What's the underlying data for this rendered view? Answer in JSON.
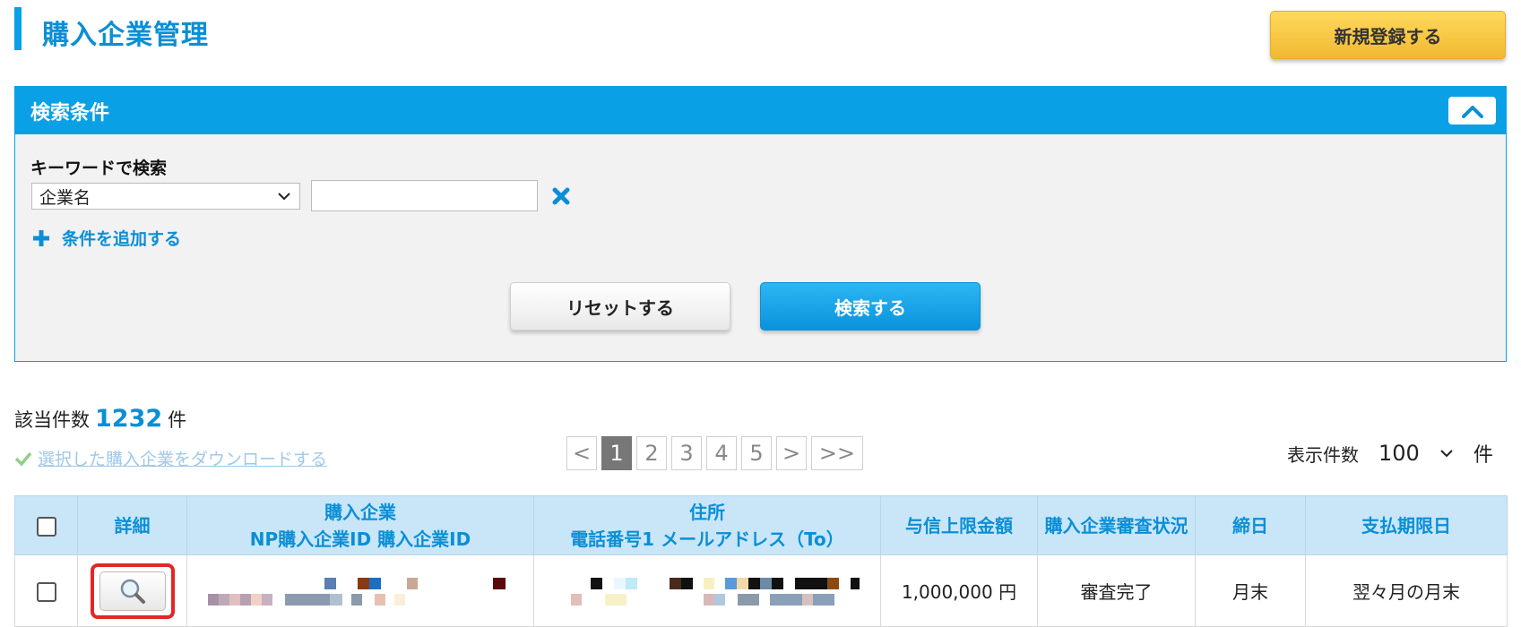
{
  "header": {
    "title": "購入企業管理",
    "register_label": "新規登録する",
    "colors": {
      "accent": "#0aa0e6",
      "register": "#f5c843"
    }
  },
  "search": {
    "title": "検索条件",
    "keyword_label": "キーワードで検索",
    "field_select_value": "企業名",
    "keyword_value": "",
    "add_condition_label": "条件を追加する",
    "reset_label": "リセットする",
    "search_label": "検索する",
    "icons": [
      "chevron-up-icon",
      "chevron-down-icon",
      "close-icon",
      "plus-icon"
    ]
  },
  "results": {
    "count_prefix": "該当件数",
    "count": "1232",
    "count_suffix": "件",
    "download_label": "選択した購入企業をダウンロードする",
    "pagination": [
      "<",
      "1",
      "2",
      "3",
      "4",
      "5",
      ">",
      ">>"
    ],
    "current_page": "1",
    "per_page_label": "表示件数",
    "per_page_value": "100",
    "per_page_unit": "件"
  },
  "table": {
    "headers": {
      "detail": "詳細",
      "company_line1": "購入企業",
      "company_line2": "NP購入企業ID 購入企業ID",
      "address_line1": "住所",
      "address_line2": "電話番号1 メールアドレス（To）",
      "credit_limit": "与信上限金額",
      "review_status": "購入企業審査状況",
      "closing_day": "締日",
      "payment_due": "支払期限日"
    },
    "rows": [
      {
        "credit_limit": "1,000,000 円",
        "review_status": "審査完了",
        "closing_day": "月末",
        "payment_due": "翌々月の月末"
      }
    ]
  }
}
